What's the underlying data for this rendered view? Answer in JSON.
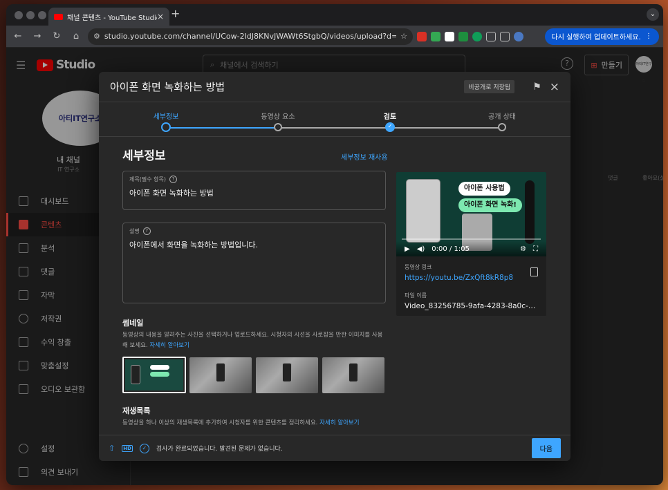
{
  "browser": {
    "tab_title": "채널 콘텐츠 - YouTube Studio",
    "url": "studio.youtube.com/channel/UCow-2IdJ8KNvJWAWt6StgbQ/videos/upload?d=ud&filt...",
    "update_label": "다시 실행하여 업데이트하세요."
  },
  "studio": {
    "logo": "Studio",
    "search_placeholder": "채널에서 검색하기",
    "create_label": "만들기",
    "avatar_text": "아티IT연구소",
    "channel_name": "내 채널",
    "channel_sub": "IT 연구소",
    "nav": [
      {
        "label": "대시보드"
      },
      {
        "label": "콘텐츠"
      },
      {
        "label": "분석"
      },
      {
        "label": "댓글"
      },
      {
        "label": "자막"
      },
      {
        "label": "저작권"
      },
      {
        "label": "수익 창출"
      },
      {
        "label": "맞춤설정"
      },
      {
        "label": "오디오 보관함"
      },
      {
        "label": "설정"
      },
      {
        "label": "의견 보내기"
      }
    ],
    "bg_col_comments": "댓글",
    "bg_col_likes": "좋아요(싫어요 대비"
  },
  "modal": {
    "title": "아이폰 화면 녹화하는 방법",
    "saved_badge": "비공개로 저장됨",
    "steps": [
      {
        "label": "세부정보"
      },
      {
        "label": "동영상 요소"
      },
      {
        "label": "검토"
      },
      {
        "label": "공개 상태"
      }
    ],
    "section_title": "세부정보",
    "reuse_label": "세부정보 재사용",
    "title_field": {
      "label": "제목(필수 항목)",
      "value": "아이폰 화면 녹화하는 방법"
    },
    "desc_field": {
      "label": "설명",
      "value": "아이폰에서 화면을 녹화하는 방법입니다."
    },
    "thumbnail": {
      "heading": "썸네일",
      "text": "동영상의 내용을 알려주는 사진을 선택하거나 업로드하세요. 시청자의 시선을 사로잡을 만한 이미지를 사용해 보세요.",
      "link": "자세히 알아보기"
    },
    "playlist": {
      "heading": "재생목록",
      "text": "동영상을 하나 이상의 재생목록에 추가하여 시청자를 위한 콘텐츠를 정리하세요.",
      "link": "자세히 알아보기"
    },
    "video": {
      "pill1": "아이폰 사용법",
      "pill2": "아이폰 화면 녹화!",
      "time": "0:00 / 1:05",
      "link_label": "동영상 링크",
      "link": "https://youtu.be/ZxQft8kR8p8",
      "file_label": "파일 이름",
      "file": "Video_83256785-9afa-4283-8a0c-da39..."
    },
    "footer_status": "검사가 완료되었습니다. 발견된 문제가 없습니다.",
    "next_label": "다음"
  },
  "colors": {
    "accent": "#3ea6ff",
    "youtube_red": "#ff0000",
    "active_nav": "#ff4e45"
  }
}
